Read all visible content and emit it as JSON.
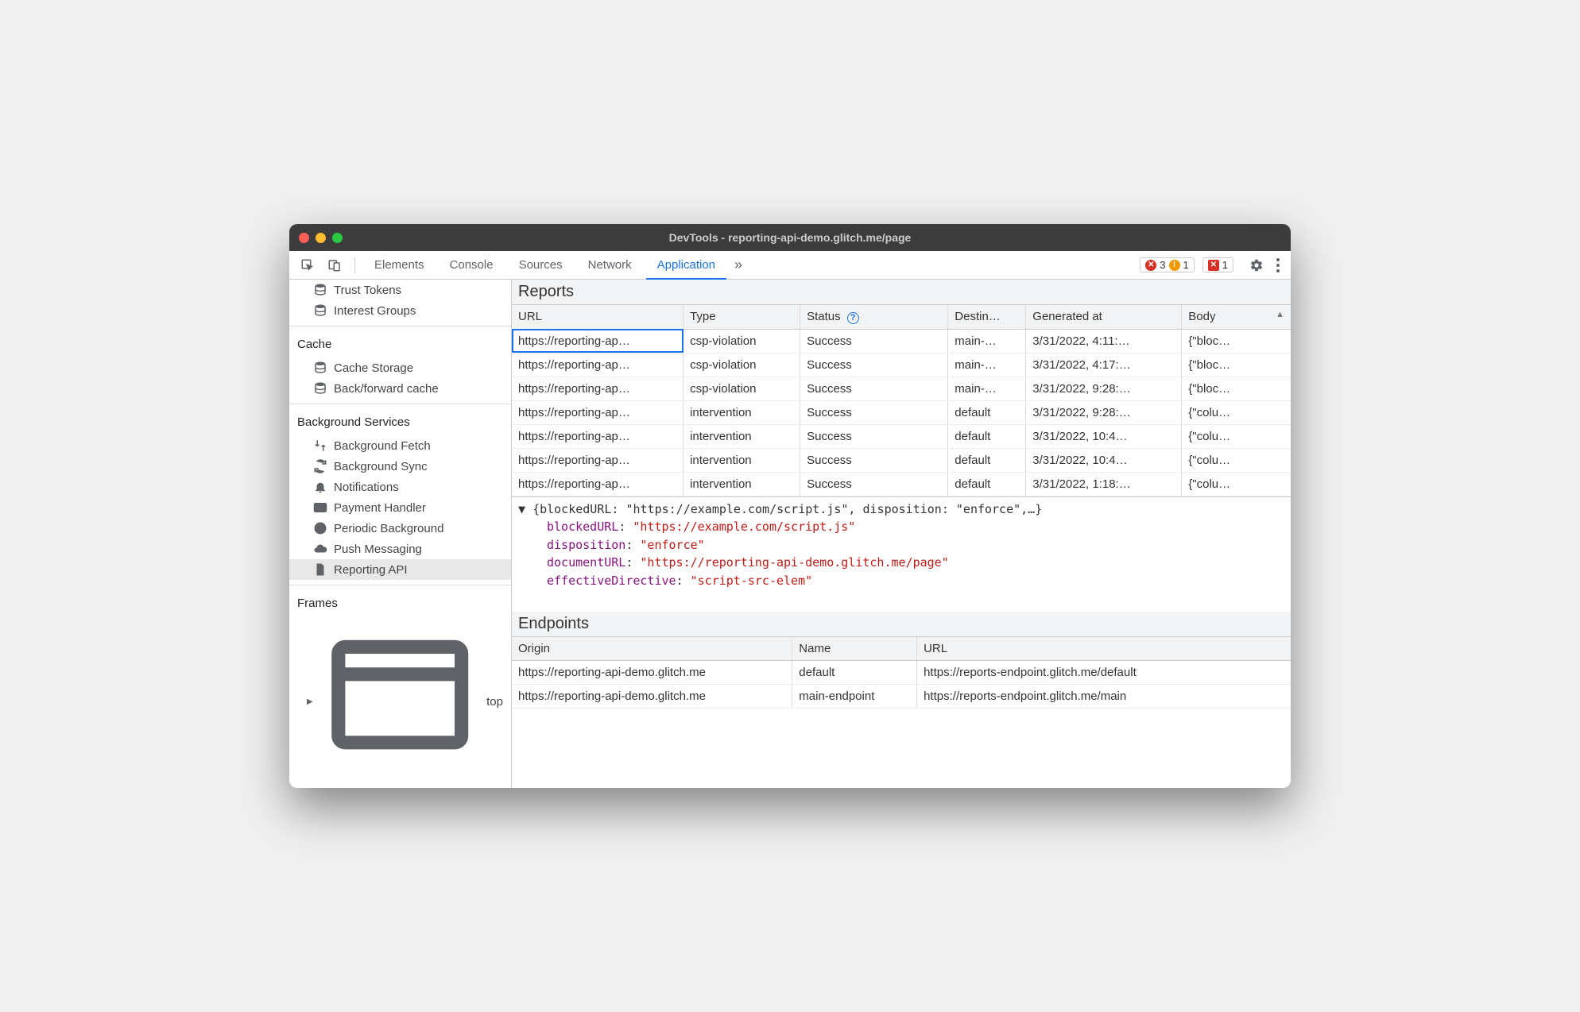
{
  "window": {
    "title": "DevTools - reporting-api-demo.glitch.me/page"
  },
  "tabs": [
    "Elements",
    "Console",
    "Sources",
    "Network",
    "Application"
  ],
  "activeTab": "Application",
  "badges": {
    "errors": "3",
    "warnings": "1",
    "issues": "1"
  },
  "sidebar": {
    "topItems": [
      "Trust Tokens",
      "Interest Groups"
    ],
    "sections": [
      {
        "title": "Cache",
        "items": [
          {
            "label": "Cache Storage",
            "icon": "db"
          },
          {
            "label": "Back/forward cache",
            "icon": "db"
          }
        ]
      },
      {
        "title": "Background Services",
        "items": [
          {
            "label": "Background Fetch",
            "icon": "fetch"
          },
          {
            "label": "Background Sync",
            "icon": "sync"
          },
          {
            "label": "Notifications",
            "icon": "bell"
          },
          {
            "label": "Payment Handler",
            "icon": "card"
          },
          {
            "label": "Periodic Background",
            "icon": "clock"
          },
          {
            "label": "Push Messaging",
            "icon": "cloud"
          },
          {
            "label": "Reporting API",
            "icon": "file",
            "selected": true
          }
        ]
      },
      {
        "title": "Frames",
        "items": [
          {
            "label": "top",
            "icon": "frame",
            "expandable": true
          }
        ]
      }
    ]
  },
  "reports": {
    "title": "Reports",
    "columns": [
      "URL",
      "Type",
      "Status",
      "Destin…",
      "Generated at",
      "Body"
    ],
    "sortColumn": "Body",
    "rows": [
      {
        "url": "https://reporting-ap…",
        "type": "csp-violation",
        "status": "Success",
        "dest": "main-…",
        "gen": "3/31/2022, 4:11:…",
        "body": "{\"bloc…",
        "selected": true
      },
      {
        "url": "https://reporting-ap…",
        "type": "csp-violation",
        "status": "Success",
        "dest": "main-…",
        "gen": "3/31/2022, 4:17:…",
        "body": "{\"bloc…"
      },
      {
        "url": "https://reporting-ap…",
        "type": "csp-violation",
        "status": "Success",
        "dest": "main-…",
        "gen": "3/31/2022, 9:28:…",
        "body": "{\"bloc…"
      },
      {
        "url": "https://reporting-ap…",
        "type": "intervention",
        "status": "Success",
        "dest": "default",
        "gen": "3/31/2022, 9:28:…",
        "body": "{\"colu…"
      },
      {
        "url": "https://reporting-ap…",
        "type": "intervention",
        "status": "Success",
        "dest": "default",
        "gen": "3/31/2022, 10:4…",
        "body": "{\"colu…"
      },
      {
        "url": "https://reporting-ap…",
        "type": "intervention",
        "status": "Success",
        "dest": "default",
        "gen": "3/31/2022, 10:4…",
        "body": "{\"colu…"
      },
      {
        "url": "https://reporting-ap…",
        "type": "intervention",
        "status": "Success",
        "dest": "default",
        "gen": "3/31/2022, 1:18:…",
        "body": "{\"colu…"
      }
    ]
  },
  "detail": {
    "summary": "{blockedURL: \"https://example.com/script.js\", disposition: \"enforce\",…}",
    "props": [
      {
        "key": "blockedURL",
        "value": "\"https://example.com/script.js\""
      },
      {
        "key": "disposition",
        "value": "\"enforce\""
      },
      {
        "key": "documentURL",
        "value": "\"https://reporting-api-demo.glitch.me/page\""
      },
      {
        "key": "effectiveDirective",
        "value": "\"script-src-elem\""
      }
    ]
  },
  "endpoints": {
    "title": "Endpoints",
    "columns": [
      "Origin",
      "Name",
      "URL"
    ],
    "rows": [
      {
        "origin": "https://reporting-api-demo.glitch.me",
        "name": "default",
        "url": "https://reports-endpoint.glitch.me/default"
      },
      {
        "origin": "https://reporting-api-demo.glitch.me",
        "name": "main-endpoint",
        "url": "https://reports-endpoint.glitch.me/main"
      }
    ]
  }
}
